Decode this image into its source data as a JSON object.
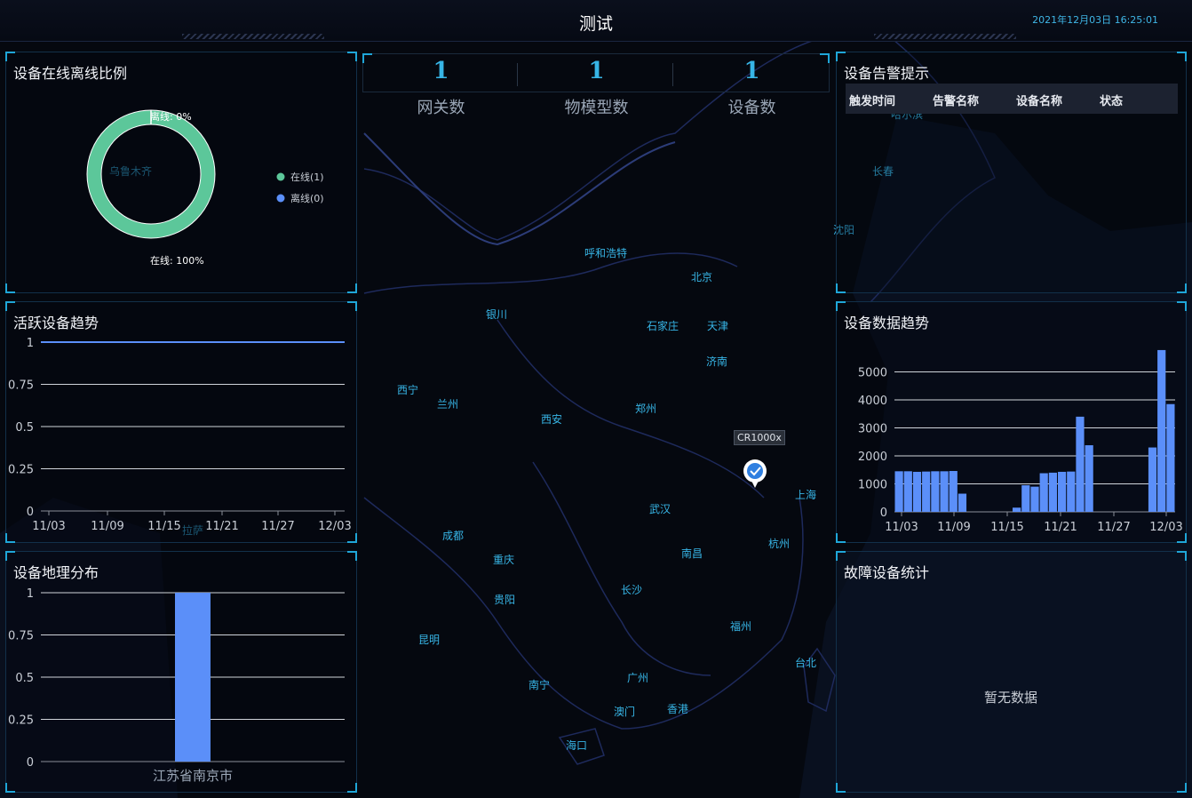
{
  "header": {
    "title": "测试",
    "datetime": "2021年12月03日 16:25:01"
  },
  "online_ratio": {
    "title": "设备在线离线比例",
    "label_offline": "离线: 0%",
    "label_online": "在线: 100%",
    "legend": [
      "在线(1)",
      "离线(0)"
    ],
    "online_count": 1,
    "offline_count": 0,
    "colors": {
      "online": "#5cc79a",
      "offline": "#5b8ff9"
    }
  },
  "stats": [
    {
      "value": "1",
      "label": "网关数"
    },
    {
      "value": "1",
      "label": "物模型数"
    },
    {
      "value": "1",
      "label": "设备数"
    }
  ],
  "alarm": {
    "title": "设备告警提示",
    "columns": [
      "触发时间",
      "告警名称",
      "设备名称",
      "状态"
    ]
  },
  "active_trend": {
    "title": "活跃设备趋势"
  },
  "data_trend": {
    "title": "设备数据趋势"
  },
  "geo": {
    "title": "设备地理分布"
  },
  "fault": {
    "title": "故障设备统计",
    "empty_text": "暂无数据"
  },
  "map": {
    "marker_label": "CR1000x",
    "cities": [
      "乌鲁木齐",
      "哈尔滨",
      "长春",
      "沈阳",
      "呼和浩特",
      "北京",
      "银川",
      "石家庄",
      "天津",
      "济南",
      "西宁",
      "兰州",
      "西安",
      "郑州",
      "上海",
      "武汉",
      "杭州",
      "成都",
      "重庆",
      "南昌",
      "贵阳",
      "长沙",
      "昆明",
      "福州",
      "台北",
      "南宁",
      "广州",
      "澳门",
      "香港",
      "海口",
      "拉萨"
    ],
    "colors": {
      "city": "#37b5e6",
      "border": "#1e2a5c"
    }
  },
  "chart_data": [
    {
      "type": "line",
      "chart": "active_trend",
      "x_ticks": [
        "11/03",
        "11/09",
        "11/15",
        "11/21",
        "11/27",
        "12/03"
      ],
      "y_ticks": [
        "0",
        "0.25",
        "0.5",
        "0.75",
        "1"
      ],
      "ylim": [
        0,
        1
      ],
      "series": [
        {
          "values": [
            1,
            1,
            1,
            1,
            1,
            1,
            1,
            1,
            1,
            1,
            1,
            1,
            1,
            1,
            1,
            1,
            1,
            1,
            1,
            1,
            1,
            1,
            1,
            1,
            1,
            1,
            1,
            1,
            1,
            1,
            1
          ]
        }
      ],
      "color": "#5b8ff9",
      "grid": true
    },
    {
      "type": "bar",
      "chart": "data_trend",
      "x_ticks": [
        "11/03",
        "11/09",
        "11/15",
        "11/21",
        "11/27",
        "12/03"
      ],
      "y_ticks": [
        "0",
        "1000",
        "2000",
        "3000",
        "4000",
        "5000"
      ],
      "ylim": [
        0,
        6000
      ],
      "values": [
        1450,
        1450,
        1430,
        1440,
        1450,
        1450,
        1460,
        650,
        0,
        0,
        0,
        0,
        0,
        150,
        950,
        900,
        1380,
        1400,
        1430,
        1440,
        3400,
        2380,
        0,
        0,
        0,
        0,
        0,
        0,
        2300,
        5780,
        3850
      ],
      "color": "#5b8ff9",
      "grid": true
    },
    {
      "type": "bar",
      "chart": "geo",
      "categories": [
        "江苏省南京市"
      ],
      "values": [
        1
      ],
      "y_ticks": [
        "0",
        "0.25",
        "0.5",
        "0.75",
        "1"
      ],
      "ylim": [
        0,
        1
      ],
      "color": "#5b8ff9",
      "grid": true
    }
  ]
}
